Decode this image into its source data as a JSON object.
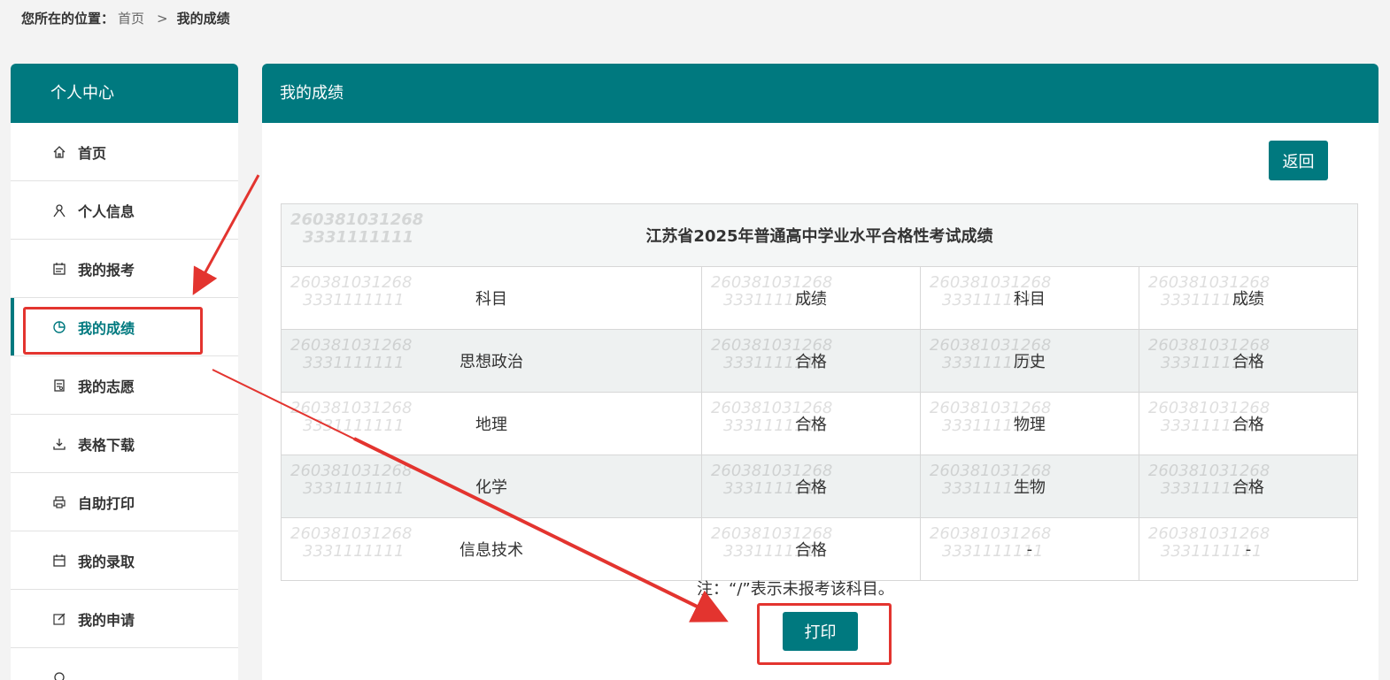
{
  "breadcrumb": {
    "label": "您所在的位置：",
    "home": "首页",
    "sep": ">",
    "current": "我的成绩"
  },
  "sidebar": {
    "title": "个人中心",
    "items": [
      {
        "label": "首页",
        "icon": "home-icon"
      },
      {
        "label": "个人信息",
        "icon": "person-icon"
      },
      {
        "label": "我的报考",
        "icon": "calendar-icon"
      },
      {
        "label": "我的成绩",
        "icon": "pie-chart-icon"
      },
      {
        "label": "我的志愿",
        "icon": "document-icon"
      },
      {
        "label": "表格下载",
        "icon": "download-icon"
      },
      {
        "label": "自助打印",
        "icon": "printer-icon"
      },
      {
        "label": "我的录取",
        "icon": "calendar-icon"
      },
      {
        "label": "我的申请",
        "icon": "edit-icon"
      }
    ]
  },
  "panel": {
    "title": "我的成绩",
    "back_label": "返回",
    "print_label": "打印"
  },
  "table": {
    "title": "江苏省2025年普通高中学业水平合格性考试成绩",
    "headers": [
      "科目",
      "成绩",
      "科目",
      "成绩"
    ],
    "rows": [
      [
        "思想政治",
        "合格",
        "历史",
        "合格"
      ],
      [
        "地理",
        "合格",
        "物理",
        "合格"
      ],
      [
        "化学",
        "合格",
        "生物",
        "合格"
      ],
      [
        "信息技术",
        "合格",
        "-",
        "-"
      ]
    ],
    "watermark_line1": "260381031268",
    "watermark_line2": "3331111111"
  },
  "note": "注：“/”表示未报考该科目。",
  "colors": {
    "accent": "#00797f",
    "annotation": "#e3342f"
  }
}
